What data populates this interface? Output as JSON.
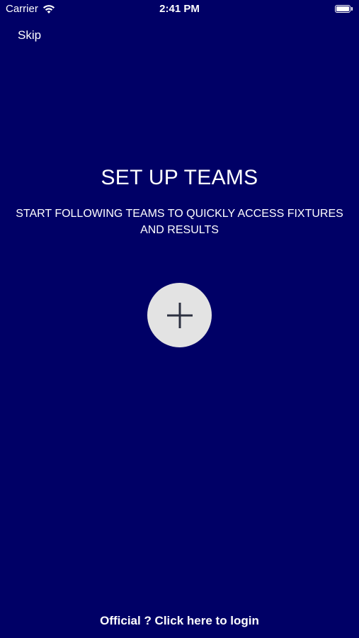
{
  "status_bar": {
    "carrier": "Carrier",
    "time": "2:41 PM",
    "wifi_icon": "wifi-icon",
    "battery_icon": "battery-icon"
  },
  "header": {
    "skip_label": "Skip"
  },
  "main": {
    "title": "SET UP TEAMS",
    "subtitle": "START FOLLOWING TEAMS TO QUICKLY ACCESS FIXTURES AND RESULTS",
    "add_icon": "plus-icon"
  },
  "footer": {
    "login_label": "Official ? Click here to login"
  },
  "colors": {
    "background": "#000066",
    "text": "#ffffff",
    "add_button_bg": "#e3e3e3",
    "plus_icon": "#2c3040"
  }
}
